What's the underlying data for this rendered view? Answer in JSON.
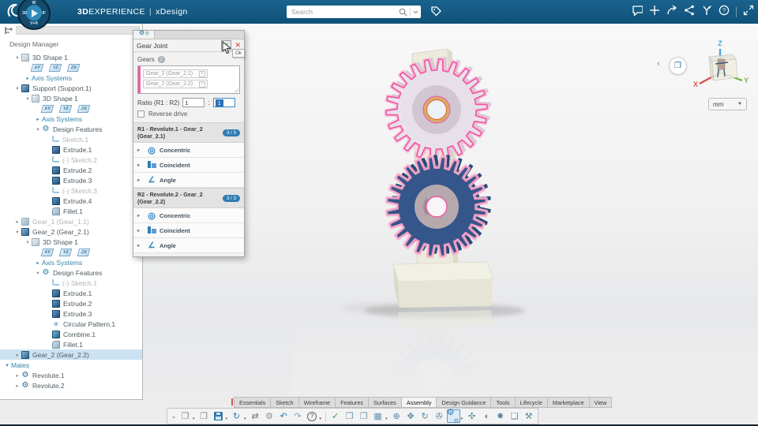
{
  "header": {
    "brand_bold": "3D",
    "brand_rest": "EXPERIENCE",
    "separator": "|",
    "app_name": "xDesign",
    "search_placeholder": "Search",
    "compass": {
      "north": "W",
      "west": "3D",
      "east": "IF",
      "south": "V+R"
    },
    "right_icons": [
      {
        "name": "notifications"
      },
      {
        "name": "add"
      },
      {
        "name": "share"
      },
      {
        "name": "collaboration"
      },
      {
        "name": "swym"
      },
      {
        "name": "help"
      },
      {
        "name": "divider"
      },
      {
        "name": "window-resize"
      }
    ]
  },
  "left_panel": {
    "title": "Design Manager",
    "tree": [
      {
        "indent": 1,
        "arrow": "v",
        "icon": "shape",
        "label": "3D Shape 1"
      },
      {
        "indent": 2,
        "planes": [
          "XY",
          "YZ",
          "ZX"
        ]
      },
      {
        "indent": 2,
        "arrow": "r",
        "label": "Axis Systems",
        "link": true
      },
      {
        "indent": 1,
        "arrow": "v",
        "icon": "support",
        "label": "Support (Support.1)"
      },
      {
        "indent": 2,
        "arrow": "v",
        "icon": "shape",
        "label": "3D Shape 1"
      },
      {
        "indent": 3,
        "planes": [
          "XY",
          "YZ",
          "ZX"
        ]
      },
      {
        "indent": 3,
        "arrow": "r",
        "label": "Axis Systems",
        "link": true
      },
      {
        "indent": 3,
        "arrow": "v",
        "icon": "features",
        "label": "Design Features"
      },
      {
        "indent": 4,
        "icon": "sketch",
        "label": "Sketch.1",
        "gray": true
      },
      {
        "indent": 4,
        "icon": "extrude",
        "label": "Extrude.1"
      },
      {
        "indent": 4,
        "icon": "sketch",
        "label": "(-) Sketch.2",
        "gray": true
      },
      {
        "indent": 4,
        "icon": "extrude",
        "label": "Extrude.2"
      },
      {
        "indent": 4,
        "icon": "extrude",
        "label": "Extrude.3"
      },
      {
        "indent": 4,
        "icon": "sketch",
        "label": "(-) Sketch.3",
        "gray": true
      },
      {
        "indent": 4,
        "icon": "extrude",
        "label": "Extrude.4"
      },
      {
        "indent": 4,
        "icon": "fillet",
        "label": "Fillet.1"
      },
      {
        "indent": 1,
        "arrow": "r",
        "icon": "component",
        "label": "Gear_1 (Gear_1.1)",
        "gray": true
      },
      {
        "indent": 1,
        "arrow": "v",
        "icon": "component",
        "label": "Gear_2 (Gear_2.1)"
      },
      {
        "indent": 2,
        "arrow": "v",
        "icon": "shape",
        "label": "3D Shape 1"
      },
      {
        "indent": 3,
        "planes": [
          "XY",
          "YZ",
          "ZX"
        ]
      },
      {
        "indent": 3,
        "arrow": "r",
        "label": "Axis Systems",
        "link": true
      },
      {
        "indent": 3,
        "arrow": "v",
        "icon": "features",
        "label": "Design Features"
      },
      {
        "indent": 4,
        "icon": "sketch",
        "label": "(-) Sketch.1",
        "gray": true
      },
      {
        "indent": 4,
        "icon": "extrude",
        "label": "Extrude.1"
      },
      {
        "indent": 4,
        "icon": "extrude",
        "label": "Extrude.2"
      },
      {
        "indent": 4,
        "icon": "extrude",
        "label": "Extrude.3"
      },
      {
        "indent": 4,
        "icon": "pattern",
        "label": "Circular Pattern.1"
      },
      {
        "indent": 4,
        "icon": "combine",
        "label": "Combine.1"
      },
      {
        "indent": 4,
        "icon": "fillet",
        "label": "Fillet.1"
      },
      {
        "indent": 1,
        "arrow": "r",
        "icon": "component",
        "label": "Gear_2 (Gear_2.2)",
        "selected": true
      },
      {
        "indent": 0,
        "arrow": "v",
        "label": "Mates",
        "link": true
      },
      {
        "indent": 1,
        "arrow": "r",
        "icon": "revolute",
        "label": "Revolute.1"
      },
      {
        "indent": 1,
        "arrow": "r",
        "icon": "revolute",
        "label": "Revolute.2"
      }
    ]
  },
  "dialog": {
    "title": "Gear Joint",
    "confirm_icon": "✓",
    "close_icon": "✕",
    "ok_tooltip": "Ok",
    "gears_label": "Gears",
    "gears_count": "2",
    "chips": [
      "Gear_2 (Gear_2.1)",
      "Gear_2 (Gear_2.2)"
    ],
    "chip_remove_icon": "×",
    "ratio_label": "Ratio (R1 : R2)",
    "ratio_r1": "1",
    "ratio_separator": ":",
    "ratio_r2": "1",
    "reverse_label": "Reverse drive",
    "sections": [
      {
        "header": "R1 - Revolute.1 - Gear_2 (Gear_2.1)",
        "badge": "3 / 3",
        "rows": [
          {
            "icon": "concentric",
            "label": "Concentric"
          },
          {
            "icon": "coincident",
            "label": "Coincident"
          },
          {
            "icon": "angle",
            "label": "Angle"
          }
        ]
      },
      {
        "header": "R2 - Revolute.2 - Gear_2 (Gear_2.2)",
        "badge": "3 / 3",
        "rows": [
          {
            "icon": "concentric",
            "label": "Concentric"
          },
          {
            "icon": "coincident",
            "label": "Coincident"
          },
          {
            "icon": "angle",
            "label": "Angle"
          }
        ]
      }
    ]
  },
  "viewport": {
    "units": "mm",
    "triad": {
      "x": "X",
      "y": "Y",
      "z": "Z"
    },
    "colors": {
      "gear_top_fill": "#e9e2ea",
      "gear_top_outline": "#ee55a0",
      "gear_top_hub": "#d8ab6e",
      "gear_bottom_fill": "#35568a",
      "gear_bottom_outline": "#f49ac1",
      "gear_bottom_hub": "#b6a9ae",
      "support_fill": "#ecebdd"
    }
  },
  "bottom_tabs": {
    "tabs": [
      {
        "label": "Essentials"
      },
      {
        "label": "Sketch"
      },
      {
        "label": "Wireframe"
      },
      {
        "label": "Features"
      },
      {
        "label": "Surfaces"
      },
      {
        "label": "Assembly",
        "active": true
      },
      {
        "label": "Design Guidance"
      },
      {
        "label": "Tools"
      },
      {
        "label": "Lifecycle"
      },
      {
        "label": "Marketplace"
      },
      {
        "label": "View"
      }
    ]
  },
  "toolbar": {
    "items": [
      {
        "name": "collapse-toolbar",
        "glyph": "⌄",
        "color": "#666",
        "small": true
      },
      {
        "name": "new-content",
        "glyph": "❒",
        "color": "#7c8f9d",
        "caret": true
      },
      {
        "name": "open-content",
        "glyph": "❐",
        "color": "#7c8f9d"
      },
      {
        "name": "save",
        "kind": "floppy",
        "caret": true
      },
      {
        "name": "refresh",
        "glyph": "↻",
        "color": "#2f7fb5",
        "caret": true
      },
      {
        "name": "transfer",
        "glyph": "⇄",
        "color": "#5a7b8c"
      },
      {
        "name": "settings",
        "glyph": "⚙",
        "color": "#8a8f94"
      },
      {
        "name": "undo",
        "glyph": "↶",
        "color": "#2f7fb5"
      },
      {
        "name": "redo",
        "glyph": "↷",
        "color": "#7da7c4"
      },
      {
        "name": "help",
        "kind": "qcirc",
        "glyph": "?",
        "caret": true,
        "sep_after": true
      },
      {
        "name": "link-check",
        "glyph": "✓",
        "color": "#3a9e3a"
      },
      {
        "name": "insert-component",
        "glyph": "❒",
        "color": "#6b93ad"
      },
      {
        "name": "insert-assembly",
        "glyph": "❐",
        "color": "#6b93ad"
      },
      {
        "name": "component-pattern",
        "glyph": "▦",
        "color": "#6b93ad",
        "caret": true
      },
      {
        "name": "anchor-component",
        "glyph": "⊕",
        "color": "#5f87a0"
      },
      {
        "name": "move-component",
        "glyph": "✥",
        "color": "#5f87a0"
      },
      {
        "name": "rotate-component",
        "glyph": "↻",
        "color": "#5f87a0"
      },
      {
        "name": "attach",
        "glyph": "✇",
        "color": "#5f87a0"
      },
      {
        "name": "gear-joint",
        "kind": "gears",
        "active": true,
        "caret": true
      },
      {
        "name": "screw-joint",
        "glyph": "✣",
        "color": "#5f87a0"
      },
      {
        "name": "hinge-joint",
        "glyph": "◖",
        "color": "#5f87a0"
      },
      {
        "name": "collision-detection",
        "glyph": "✸",
        "color": "#5f87a0"
      },
      {
        "name": "bounding-box",
        "glyph": "❑",
        "color": "#5f87a0"
      },
      {
        "name": "kinematics",
        "glyph": "⚒",
        "color": "#5f87a0"
      }
    ]
  }
}
